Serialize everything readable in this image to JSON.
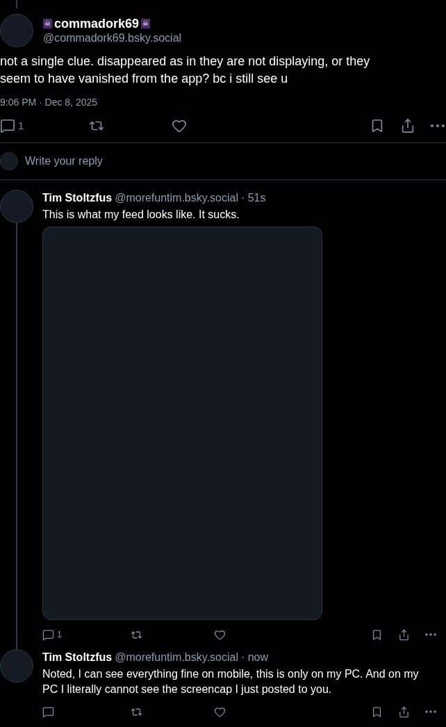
{
  "main_post": {
    "name_prefix": "☠",
    "name": "commadork69",
    "name_suffix": "☠",
    "handle": "@commadork69.bsky.social",
    "text": "not a single clue. disappeared as in they are not displaying, or they seem to have vanished from the app? bc i still see u",
    "timestamp": "9:06 PM · Dec 8, 2025",
    "actions": {
      "reply_count": "1"
    }
  },
  "reply_box": {
    "placeholder": "Write your reply"
  },
  "replies": [
    {
      "name": "Tim Stoltzfus",
      "handle": "@morefuntim.bsky.social",
      "time": "· 51s",
      "text": "This is what my feed looks like. It sucks.",
      "attachment": {
        "kind": "blank_image"
      },
      "actions": {
        "reply_count": "1"
      }
    },
    {
      "name": "Tim Stoltzfus",
      "handle": "@morefuntim.bsky.social",
      "time": "· now",
      "text": "Noted, I can see everything fine on mobile, this is only on my PC. And on my PC I literally cannot see the screencap I just posted to you."
    }
  ]
}
